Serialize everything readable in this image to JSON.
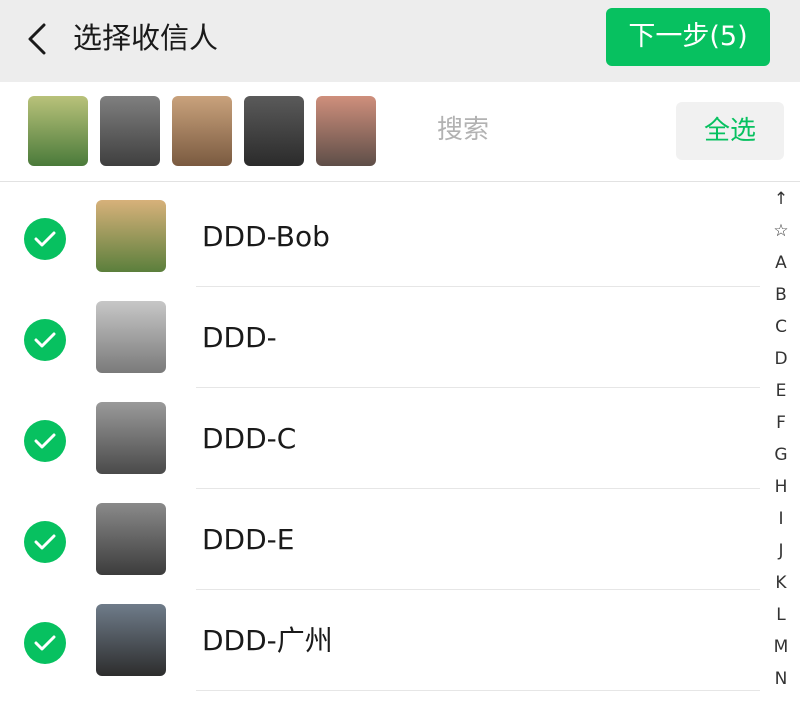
{
  "header": {
    "back_icon": "chevron-left-icon",
    "title": "选择收信人",
    "next_label": "下一步(5)"
  },
  "search": {
    "placeholder": "搜索",
    "select_all_label": "全选",
    "selected_avatars": [
      {
        "color_top": "#b9c27a",
        "color_bottom": "#4a7a3a"
      },
      {
        "color_top": "#7f7f7f",
        "color_bottom": "#3f3f3f"
      },
      {
        "color_top": "#c9a27c",
        "color_bottom": "#7a5a40"
      },
      {
        "color_top": "#5a5a5a",
        "color_bottom": "#2b2b2b"
      },
      {
        "color_top": "#cf8f7c",
        "color_bottom": "#5e4e48"
      }
    ]
  },
  "contacts": [
    {
      "name": "DDD-Bob",
      "checked": true,
      "avatar_top": "#d7b17a",
      "avatar_bottom": "#5b7f3c"
    },
    {
      "name": "DDD-",
      "checked": true,
      "avatar_top": "#c7c7c7",
      "avatar_bottom": "#7a7a7a"
    },
    {
      "name": "DDD-C",
      "checked": true,
      "avatar_top": "#9a9a9a",
      "avatar_bottom": "#4a4a4a"
    },
    {
      "name": "DDD-E",
      "checked": true,
      "avatar_top": "#8a8a8a",
      "avatar_bottom": "#3c3c3c"
    },
    {
      "name": "DDD-广州",
      "checked": true,
      "avatar_top": "#6f7c8a",
      "avatar_bottom": "#2d2d2d"
    }
  ],
  "index_bar": [
    "↑",
    "☆",
    "A",
    "B",
    "C",
    "D",
    "E",
    "F",
    "G",
    "H",
    "I",
    "J",
    "K",
    "L",
    "M",
    "N"
  ],
  "colors": {
    "accent": "#07c160",
    "header_bg": "#ededed",
    "placeholder": "#b2b2b2"
  }
}
